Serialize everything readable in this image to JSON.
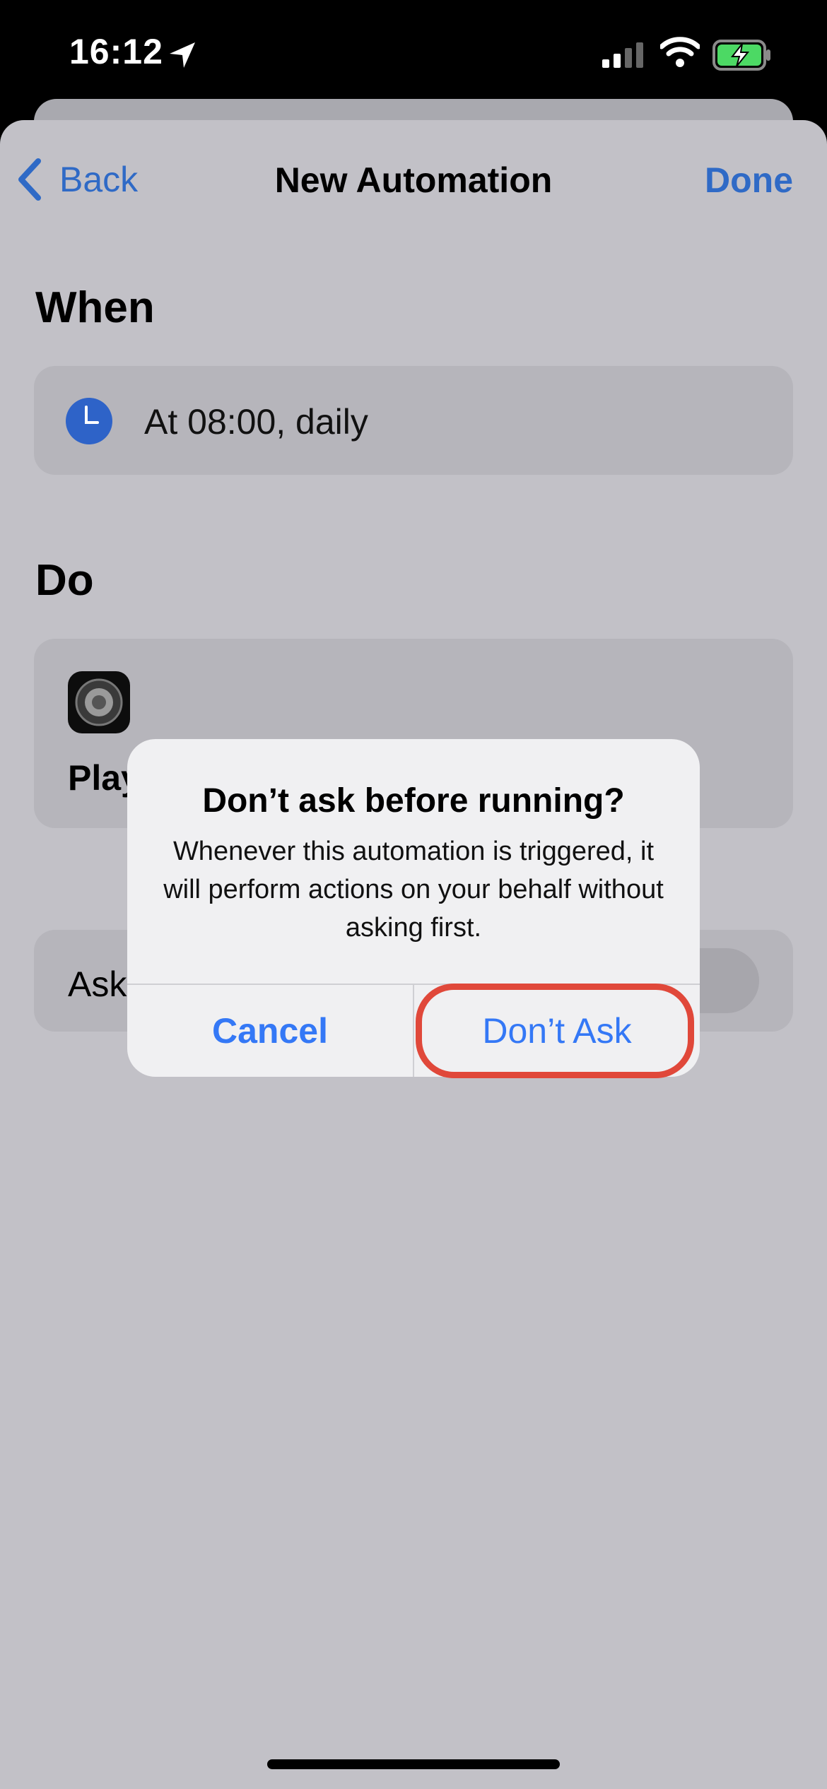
{
  "status_bar": {
    "time": "16:12"
  },
  "nav": {
    "back_label": "Back",
    "title": "New Automation",
    "done_label": "Done"
  },
  "when": {
    "heading": "When",
    "trigger_icon": "clock-icon",
    "trigger_label": "At 08:00, daily"
  },
  "do": {
    "heading": "Do",
    "action_icon": "speaker-icon",
    "action_label_visible": "Play"
  },
  "ask_row": {
    "label_visible": "Ask"
  },
  "alert": {
    "title": "Don’t ask before running?",
    "message": "Whenever this automation is triggered, it will perform actions on your behalf without asking first.",
    "cancel_label": "Cancel",
    "confirm_label": "Don’t Ask"
  },
  "colors": {
    "accent": "#3478f6",
    "highlight": "#e0483a",
    "battery_charging": "#4cd964"
  }
}
